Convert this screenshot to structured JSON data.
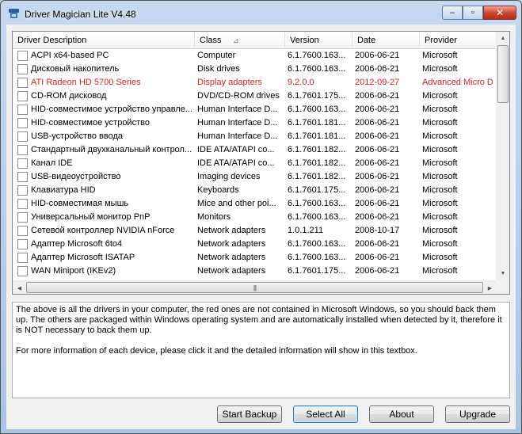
{
  "window": {
    "title": "Driver Magician Lite V4.48"
  },
  "caption": {
    "minimize": "–",
    "maximize": "▫",
    "close": "✕"
  },
  "columns": [
    "Driver Description",
    "Class",
    "Version",
    "Date",
    "Provider"
  ],
  "sort_indicator": "⊿",
  "drivers": [
    {
      "desc": "ACPI x64-based PC",
      "class": "Computer",
      "version": "6.1.7600.163...",
      "date": "2006-06-21",
      "provider": "Microsoft",
      "red": false
    },
    {
      "desc": "Дисковый накопитель",
      "class": "Disk drives",
      "version": "6.1.7600.163...",
      "date": "2006-06-21",
      "provider": "Microsoft",
      "red": false
    },
    {
      "desc": "ATI Radeon HD 5700 Series",
      "class": "Display adapters",
      "version": "9.2.0.0",
      "date": "2012-09-27",
      "provider": "Advanced Micro D",
      "red": true
    },
    {
      "desc": "CD-ROM дисковод",
      "class": "DVD/CD-ROM drives",
      "version": "6.1.7601.175...",
      "date": "2006-06-21",
      "provider": "Microsoft",
      "red": false
    },
    {
      "desc": "HID-совместимое устройство управле...",
      "class": "Human Interface D...",
      "version": "6.1.7600.163...",
      "date": "2006-06-21",
      "provider": "Microsoft",
      "red": false
    },
    {
      "desc": "HID-совместимое устройство",
      "class": "Human Interface D...",
      "version": "6.1.7601.181...",
      "date": "2006-06-21",
      "provider": "Microsoft",
      "red": false
    },
    {
      "desc": "USB-устройство ввода",
      "class": "Human Interface D...",
      "version": "6.1.7601.181...",
      "date": "2006-06-21",
      "provider": "Microsoft",
      "red": false
    },
    {
      "desc": "Стандартный двухканальный контрол...",
      "class": "IDE ATA/ATAPI co...",
      "version": "6.1.7601.182...",
      "date": "2006-06-21",
      "provider": "Microsoft",
      "red": false
    },
    {
      "desc": "Канал IDE",
      "class": "IDE ATA/ATAPI co...",
      "version": "6.1.7601.182...",
      "date": "2006-06-21",
      "provider": "Microsoft",
      "red": false
    },
    {
      "desc": "USB-видеоустройство",
      "class": "Imaging devices",
      "version": "6.1.7601.182...",
      "date": "2006-06-21",
      "provider": "Microsoft",
      "red": false
    },
    {
      "desc": "Клавиатура HID",
      "class": "Keyboards",
      "version": "6.1.7601.175...",
      "date": "2006-06-21",
      "provider": "Microsoft",
      "red": false
    },
    {
      "desc": "HID-совместимая мышь",
      "class": "Mice and other poi...",
      "version": "6.1.7600.163...",
      "date": "2006-06-21",
      "provider": "Microsoft",
      "red": false
    },
    {
      "desc": "Универсальный монитор PnP",
      "class": "Monitors",
      "version": "6.1.7600.163...",
      "date": "2006-06-21",
      "provider": "Microsoft",
      "red": false
    },
    {
      "desc": "Сетевой контроллер NVIDIA nForce",
      "class": "Network adapters",
      "version": "1.0.1.211",
      "date": "2008-10-17",
      "provider": "Microsoft",
      "red": false
    },
    {
      "desc": "Адаптер Microsoft 6to4",
      "class": "Network adapters",
      "version": "6.1.7600.163...",
      "date": "2006-06-21",
      "provider": "Microsoft",
      "red": false
    },
    {
      "desc": "Адаптер Microsoft ISATAP",
      "class": "Network adapters",
      "version": "6.1.7600.163...",
      "date": "2006-06-21",
      "provider": "Microsoft",
      "red": false
    },
    {
      "desc": "WAN Miniport (IKEv2)",
      "class": "Network adapters",
      "version": "6.1.7601.175...",
      "date": "2006-06-21",
      "provider": "Microsoft",
      "red": false
    }
  ],
  "info": {
    "paragraph1": "The above is all the drivers in your computer, the red ones are not contained in Microsoft Windows, so you should back them up. The others are packaged within Windows operating system and are automatically installed when detected by it, therefore it is NOT necessary to back them up.",
    "paragraph2": "For more information of each device, please click it and the detailed information will show in this textbox."
  },
  "buttons": {
    "start_backup": "Start Backup",
    "select_all": "Select All",
    "about": "About",
    "upgrade": "Upgrade"
  },
  "colors": {
    "highlight_red": "#e02020",
    "title_bg": "#b9d1ea"
  }
}
